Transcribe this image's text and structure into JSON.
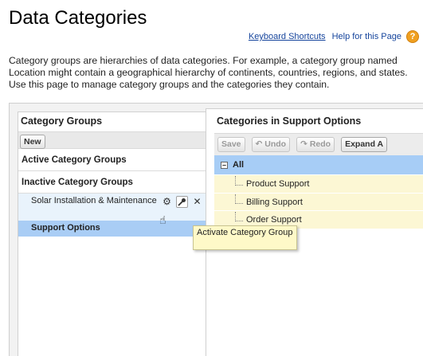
{
  "page": {
    "title": "Data Categories",
    "links": {
      "keyboard_shortcuts": "Keyboard Shortcuts",
      "help_page": "Help for this Page"
    },
    "intro": "Category groups are hierarchies of data categories. For example, a category group named Location might contain a geographical hierarchy of continents, countries, regions, and states. Use this page to manage category groups and the categories they contain."
  },
  "left_panel": {
    "title": "Category Groups",
    "new_button": "New",
    "active_header": "Active Category Groups",
    "inactive_header": "Inactive Category Groups",
    "items": [
      {
        "label": "Solar Installation & Maintenance",
        "state": "hover",
        "actions": [
          "gear-icon",
          "key-icon",
          "close-icon"
        ]
      },
      {
        "label": "Support Options",
        "state": "selected"
      }
    ]
  },
  "right_panel": {
    "title": "Categories in Support Options",
    "buttons": {
      "save": "Save",
      "undo": "Undo",
      "redo": "Redo",
      "expand_all": "Expand A"
    },
    "tree": {
      "root": "All",
      "children": [
        "Product Support",
        "Billing Support",
        "Order Support"
      ]
    }
  },
  "tooltip": "Activate Category Group",
  "colors": {
    "selected_row": "#a9cdf5",
    "tree_child_bg": "#fcf7d4",
    "tooltip_bg": "#fef9c8",
    "link": "#15449c"
  }
}
